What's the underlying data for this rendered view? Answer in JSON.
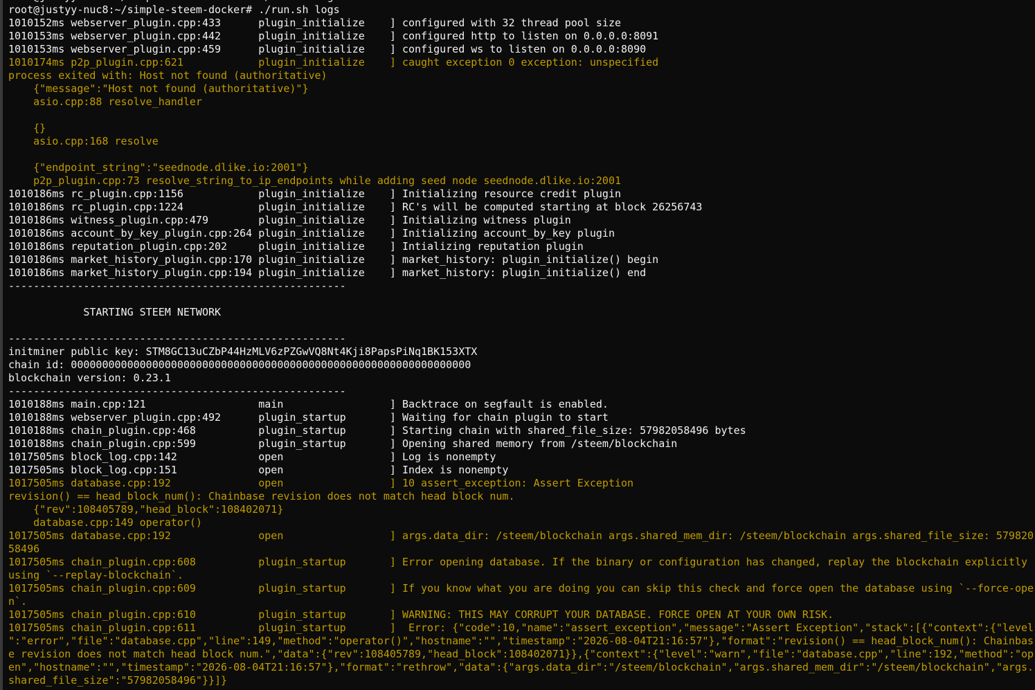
{
  "terminal": {
    "colors": {
      "background": "#0c0c0c",
      "text": "#f2f2f2",
      "warning_text": "#c19c00"
    },
    "lines": [
      {
        "text": "root@justyy-nuc8:~/simple-steem-docker# ./run.sh logs",
        "style": "normal"
      },
      {
        "text": "root@justyy-nuc8:~/simple-steem-docker# ./run.sh logs",
        "style": "normal"
      },
      {
        "text": "1010152ms webserver_plugin.cpp:433      plugin_initialize    ] configured with 32 thread pool size",
        "style": "normal"
      },
      {
        "text": "1010153ms webserver_plugin.cpp:442      plugin_initialize    ] configured http to listen on 0.0.0.0:8091",
        "style": "normal"
      },
      {
        "text": "1010153ms webserver_plugin.cpp:459      plugin_initialize    ] configured ws to listen on 0.0.0.0:8090",
        "style": "normal"
      },
      {
        "text": "1010174ms p2p_plugin.cpp:621            plugin_initialize    ] caught exception 0 exception: unspecified",
        "style": "warn"
      },
      {
        "text": "process exited with: Host not found (authoritative)",
        "style": "warn"
      },
      {
        "text": "    {\"message\":\"Host not found (authoritative)\"}",
        "style": "warn"
      },
      {
        "text": "    asio.cpp:88 resolve_handler",
        "style": "warn"
      },
      {
        "text": "",
        "style": "normal"
      },
      {
        "text": "    {}",
        "style": "warn"
      },
      {
        "text": "    asio.cpp:168 resolve",
        "style": "warn"
      },
      {
        "text": "",
        "style": "normal"
      },
      {
        "text": "    {\"endpoint_string\":\"seednode.dlike.io:2001\"}",
        "style": "warn"
      },
      {
        "text": "    p2p_plugin.cpp:73 resolve_string_to_ip_endpoints while adding seed node seednode.dlike.io:2001",
        "style": "warn"
      },
      {
        "text": "1010186ms rc_plugin.cpp:1156            plugin_initialize    ] Initializing resource credit plugin",
        "style": "normal"
      },
      {
        "text": "1010186ms rc_plugin.cpp:1224            plugin_initialize    ] RC's will be computed starting at block 26256743",
        "style": "normal"
      },
      {
        "text": "1010186ms witness_plugin.cpp:479        plugin_initialize    ] Initializing witness plugin",
        "style": "normal"
      },
      {
        "text": "1010186ms account_by_key_plugin.cpp:264 plugin_initialize    ] Initializing account_by_key plugin",
        "style": "normal"
      },
      {
        "text": "1010186ms reputation_plugin.cpp:202     plugin_initialize    ] Intializing reputation plugin",
        "style": "normal"
      },
      {
        "text": "1010186ms market_history_plugin.cpp:170 plugin_initialize    ] market_history: plugin_initialize() begin",
        "style": "normal"
      },
      {
        "text": "1010186ms market_history_plugin.cpp:194 plugin_initialize    ] market_history: plugin_initialize() end",
        "style": "normal"
      },
      {
        "text": "------------------------------------------------------",
        "style": "normal"
      },
      {
        "text": "",
        "style": "normal"
      },
      {
        "text": "            STARTING STEEM NETWORK",
        "style": "normal"
      },
      {
        "text": "",
        "style": "normal"
      },
      {
        "text": "------------------------------------------------------",
        "style": "normal"
      },
      {
        "text": "initminer public key: STM8GC13uCZbP44HzMLV6zPZGwVQ8Nt4Kji8PapsPiNq1BK153XTX",
        "style": "normal"
      },
      {
        "text": "chain id: 0000000000000000000000000000000000000000000000000000000000000000",
        "style": "normal"
      },
      {
        "text": "blockchain version: 0.23.1",
        "style": "normal"
      },
      {
        "text": "------------------------------------------------------",
        "style": "normal"
      },
      {
        "text": "1010188ms main.cpp:121                  main                 ] Backtrace on segfault is enabled.",
        "style": "normal"
      },
      {
        "text": "1010188ms webserver_plugin.cpp:492      plugin_startup       ] Waiting for chain plugin to start",
        "style": "normal"
      },
      {
        "text": "1010188ms chain_plugin.cpp:468          plugin_startup       ] Starting chain with shared_file_size: 57982058496 bytes",
        "style": "normal"
      },
      {
        "text": "1010188ms chain_plugin.cpp:599          plugin_startup       ] Opening shared memory from /steem/blockchain",
        "style": "normal"
      },
      {
        "text": "1017505ms block_log.cpp:142             open                 ] Log is nonempty",
        "style": "normal"
      },
      {
        "text": "1017505ms block_log.cpp:151             open                 ] Index is nonempty",
        "style": "normal"
      },
      {
        "text": "1017505ms database.cpp:192              open                 ] 10 assert_exception: Assert Exception",
        "style": "warn"
      },
      {
        "text": "revision() == head_block_num(): Chainbase revision does not match head block num.",
        "style": "warn"
      },
      {
        "text": "    {\"rev\":108405789,\"head_block\":108402071}",
        "style": "warn"
      },
      {
        "text": "    database.cpp:149 operator()",
        "style": "warn"
      },
      {
        "text": "1017505ms database.cpp:192              open                 ] args.data_dir: /steem/blockchain args.shared_mem_dir: /steem/blockchain args.shared_file_size: 579820",
        "style": "warn"
      },
      {
        "text": "58496",
        "style": "warn"
      },
      {
        "text": "1017505ms chain_plugin.cpp:608          plugin_startup       ] Error opening database. If the binary or configuration has changed, replay the blockchain explicitly",
        "style": "warn"
      },
      {
        "text": "using `--replay-blockchain`.",
        "style": "warn"
      },
      {
        "text": "1017505ms chain_plugin.cpp:609          plugin_startup       ] If you know what you are doing you can skip this check and force open the database using `--force-ope",
        "style": "warn"
      },
      {
        "text": "n`.",
        "style": "warn"
      },
      {
        "text": "1017505ms chain_plugin.cpp:610          plugin_startup       ] WARNING: THIS MAY CORRUPT YOUR DATABASE. FORCE OPEN AT YOUR OWN RISK.",
        "style": "warn"
      },
      {
        "text": "1017505ms chain_plugin.cpp:611          plugin_startup       ]  Error: {\"code\":10,\"name\":\"assert_exception\",\"message\":\"Assert Exception\",\"stack\":[{\"context\":{\"level",
        "style": "warn"
      },
      {
        "text": "\":\"error\",\"file\":\"database.cpp\",\"line\":149,\"method\":\"operator()\",\"hostname\":\"\",\"timestamp\":\"2026-08-04T21:16:57\"},\"format\":\"revision() == head_block_num(): Chainbas",
        "style": "warn"
      },
      {
        "text": "e revision does not match head block num.\",\"data\":{\"rev\":108405789,\"head_block\":108402071}},{\"context\":{\"level\":\"warn\",\"file\":\"database.cpp\",\"line\":192,\"method\":\"op",
        "style": "warn"
      },
      {
        "text": "en\",\"hostname\":\"\",\"timestamp\":\"2026-08-04T21:16:57\"},\"format\":\"rethrow\",\"data\":{\"args.data_dir\":\"/steem/blockchain\",\"args.shared_mem_dir\":\"/steem/blockchain\",\"args.",
        "style": "warn"
      },
      {
        "text": "shared_file_size\":\"57982058496\"}}]}",
        "style": "warn"
      },
      {
        "text": "",
        "style": "normal"
      }
    ]
  }
}
